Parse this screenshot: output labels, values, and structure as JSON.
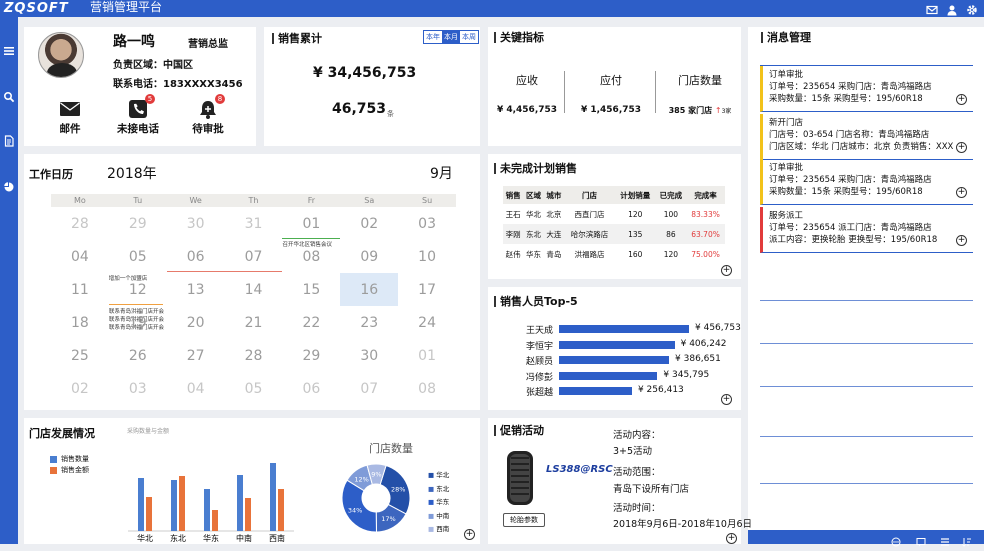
{
  "app": {
    "logo": "ZQSOFT",
    "title": "营销管理平台"
  },
  "topbar": {
    "icons": [
      "mail-icon",
      "user-icon",
      "gear-icon"
    ]
  },
  "sidebar": {
    "icons": [
      "list-icon",
      "search-icon",
      "document-icon",
      "pie-chart-icon"
    ]
  },
  "profile": {
    "name": "路一鸣",
    "role": "营销总监",
    "region": "负责区域：中国区",
    "phone": "联系电话：183XXXX3456",
    "actions": [
      {
        "label": "邮件",
        "icon": "mail-icon",
        "badge": ""
      },
      {
        "label": "未接电话",
        "icon": "phone-icon",
        "badge": "5"
      },
      {
        "label": "待审批",
        "icon": "approval-icon",
        "badge": "8"
      }
    ]
  },
  "sales": {
    "title": "销售累计",
    "period_options": [
      "本年",
      "本月",
      "本周"
    ],
    "selected_period": "本月",
    "amount": "¥  34,456,753",
    "count": "46,753",
    "count_unit": "条"
  },
  "kpi": {
    "title": "关键指标",
    "receivable": {
      "label": "应收",
      "value": "¥ 4,456,753"
    },
    "payable": {
      "label": "应付",
      "value": "¥ 1,456,753"
    },
    "stores": {
      "label": "门店数量",
      "value": "385 家门店",
      "delta": "3家"
    }
  },
  "calendar": {
    "title": "工作日历",
    "year": "2018年",
    "month": "9月",
    "weekdays": [
      "Mo",
      "Tu",
      "We",
      "Th",
      "Fr",
      "Sa",
      "Su"
    ],
    "weeks": [
      [
        "28",
        "29",
        "30",
        "31",
        "01",
        "02",
        "03"
      ],
      [
        "04",
        "05",
        "06",
        "07",
        "08",
        "09",
        "10"
      ],
      [
        "11",
        "12",
        "13",
        "14",
        "15",
        "16",
        "17"
      ],
      [
        "18",
        "19",
        "20",
        "21",
        "22",
        "23",
        "24"
      ],
      [
        "25",
        "26",
        "27",
        "28",
        "29",
        "30",
        "01"
      ],
      [
        "02",
        "03",
        "04",
        "05",
        "06",
        "07",
        "08"
      ]
    ],
    "today": "16",
    "events": {
      "meeting": "召开华北区销售会议",
      "store": "增加一个加盟店",
      "line1": "联系青岛洪福门店开会",
      "line2": "联系青岛洪福门店开会",
      "line3": "联系青岛洪福门店开会"
    }
  },
  "plan": {
    "title": "未完成计划销售",
    "headers": [
      "销售",
      "区域",
      "城市",
      "门店",
      "计划销量",
      "已完成",
      "完成率"
    ],
    "rows": [
      [
        "王石",
        "华北",
        "北京",
        "西直门店",
        "120",
        "100",
        "83.33%"
      ],
      [
        "李刚",
        "东北",
        "大连",
        "哈尔滨路店",
        "135",
        "86",
        "63.70%"
      ],
      [
        "赵伟",
        "华东",
        "青岛",
        "洪福路店",
        "160",
        "120",
        "75.00%"
      ]
    ]
  },
  "top5": {
    "title": "销售人员Top-5",
    "items": [
      {
        "name": "王天成",
        "value": 456753,
        "label": "¥  456,753"
      },
      {
        "name": "李恒宇",
        "value": 406242,
        "label": "¥  406,242"
      },
      {
        "name": "赵顾员",
        "value": 386651,
        "label": "¥  386,651"
      },
      {
        "name": "冯修彭",
        "value": 345795,
        "label": "¥  345,795"
      },
      {
        "name": "张超越",
        "value": 256413,
        "label": "¥  256,413"
      }
    ]
  },
  "messages": {
    "title": "消息管理",
    "items": [
      {
        "type": "订单审批",
        "line1": "订单号：235654     采购门店：青岛鸿福路店",
        "line2": "采购数量：15条     采购型号：195/60R18",
        "color": "#f2c21a"
      },
      {
        "type": "新开门店",
        "line1": "门店号：03-654   门店名称：青岛鸿福路店",
        "line2": "门店区域：华北   门店城市：北京  负责销售：XXX",
        "color": "#f2c21a"
      },
      {
        "type": "订单审批",
        "line1": "订单号：235654     采购门店：青岛鸿福路店",
        "line2": "采购数量：15条     采购型号：195/60R18",
        "color": "#f2c21a"
      },
      {
        "type": "服务派工",
        "line1": "订单号：235654     派工门店：青岛鸿福路店",
        "line2": "派工内容：更换轮胎     更换型号：195/60R18",
        "color": "#e13b3b"
      }
    ]
  },
  "stores": {
    "title": "门店发展情况",
    "legend": [
      "销售数量",
      "销售金额"
    ],
    "subtitle": "采购数量与金额",
    "chart_data": {
      "type": "bar",
      "categories": [
        "华北",
        "东北",
        "华东",
        "中南",
        "西南"
      ],
      "series": [
        {
          "name": "销售数量",
          "values": [
            53,
            51,
            42,
            56,
            68
          ],
          "color": "#4a7ed0"
        },
        {
          "name": "销售金额",
          "values": [
            34,
            55,
            21,
            33,
            42
          ],
          "color": "#e8733a"
        }
      ]
    },
    "donut_title": "门店数量",
    "donut": {
      "type": "pie",
      "labels": [
        "华北",
        "东北",
        "华东",
        "中南",
        "西南"
      ],
      "values": [
        28,
        17,
        34,
        12,
        9
      ],
      "colors": [
        "#2450a8",
        "#3d66bf",
        "#2d5ec8",
        "#7f9bd8",
        "#a9b9e3"
      ]
    }
  },
  "promo": {
    "title": "促销活动",
    "brand": "LS388@RSC",
    "button": "轮胎参数",
    "content_label": "活动内容：",
    "content": "3+5活动",
    "scope_label": "活动范围：",
    "scope": "青岛下设所有门店",
    "time_label": "活动时间：",
    "time": "2018年9月6日-2018年10月6日"
  }
}
